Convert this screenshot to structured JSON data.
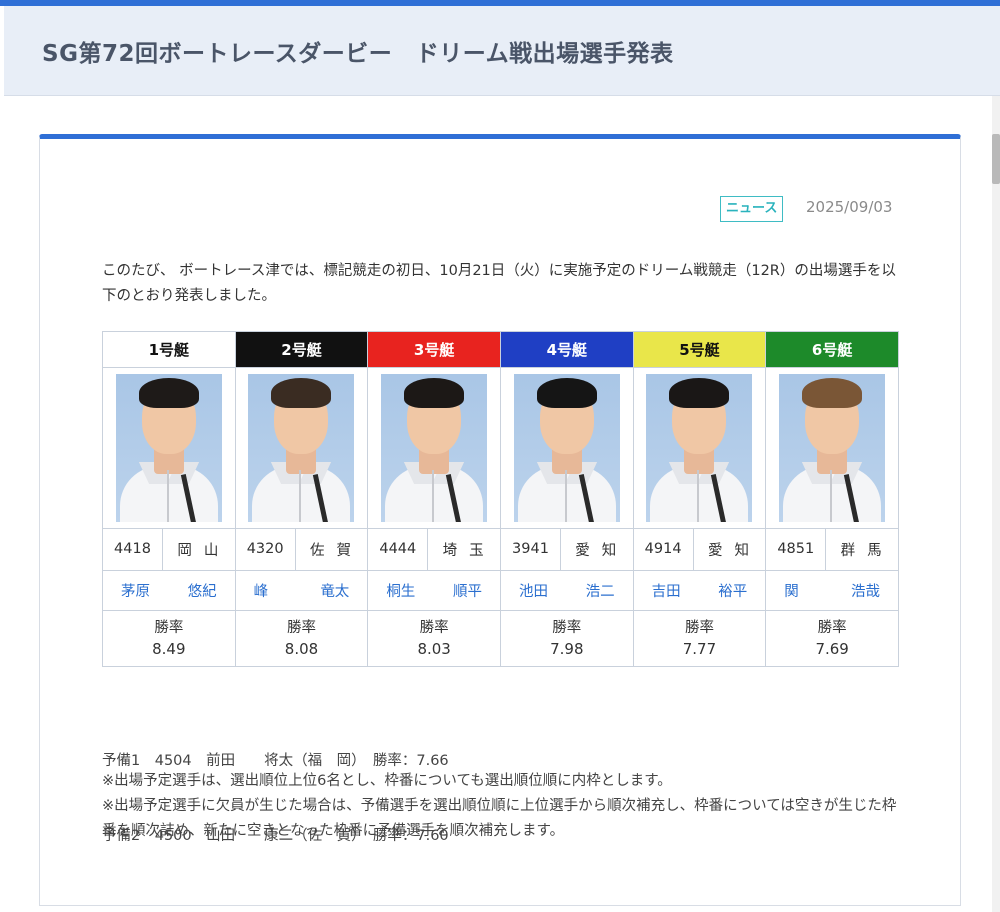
{
  "page": {
    "title": "SG第72回ボートレースダービー　ドリーム戦出場選手発表"
  },
  "article": {
    "badge": "ニュース",
    "date": "2025/09/03",
    "intro": "このたび、 ボートレース津では、標記競走の初日、10月21日（火）に実施予定のドリーム戦競走（12R）の出場選手を以下のとおり発表しました。"
  },
  "racers": [
    {
      "boat": "1号艇",
      "color_bg": "#ffffff",
      "color_fg": "#111111",
      "reg": "4418",
      "pref": "岡山",
      "family": "茅原",
      "given": "悠紀",
      "rate_label": "勝率",
      "rate": "8.49",
      "hair": "#1e1a18"
    },
    {
      "boat": "2号艇",
      "color_bg": "#111111",
      "color_fg": "#ffffff",
      "reg": "4320",
      "pref": "佐賀",
      "family": "峰",
      "given": "竜太",
      "rate_label": "勝率",
      "rate": "8.08",
      "hair": "#3a2c22"
    },
    {
      "boat": "3号艇",
      "color_bg": "#e8231f",
      "color_fg": "#ffffff",
      "reg": "4444",
      "pref": "埼玉",
      "family": "桐生",
      "given": "順平",
      "rate_label": "勝率",
      "rate": "8.03",
      "hair": "#1c1816"
    },
    {
      "boat": "4号艇",
      "color_bg": "#1f3fc4",
      "color_fg": "#ffffff",
      "reg": "3941",
      "pref": "愛知",
      "family": "池田",
      "given": "浩二",
      "rate_label": "勝率",
      "rate": "7.98",
      "hair": "#151515"
    },
    {
      "boat": "5号艇",
      "color_bg": "#e9e64a",
      "color_fg": "#111111",
      "reg": "4914",
      "pref": "愛知",
      "family": "吉田",
      "given": "裕平",
      "rate_label": "勝率",
      "rate": "7.77",
      "hair": "#1a1716"
    },
    {
      "boat": "6号艇",
      "color_bg": "#1d8a2a",
      "color_fg": "#ffffff",
      "reg": "4851",
      "pref": "群馬",
      "family": "関",
      "given": "浩哉",
      "rate_label": "勝率",
      "rate": "7.69",
      "hair": "#7a5636"
    }
  ],
  "reserves": [
    "予備1　4504　前田　　将太（福　岡）　勝率：7.66",
    "予備2　4500　山田　　康二（佐　賀）　勝率：7.60"
  ],
  "notes": [
    "※出場予定選手は、選出順位上位6名とし、枠番についても選出順位順に内枠とします。",
    "※出場予定選手に欠員が生じた場合は、予備選手を選出順位順に上位選手から順次補充し、枠番については空きが生じた枠番を順次詰め、新たに空きとなった枠番に予備選手を順次補充します。"
  ]
}
